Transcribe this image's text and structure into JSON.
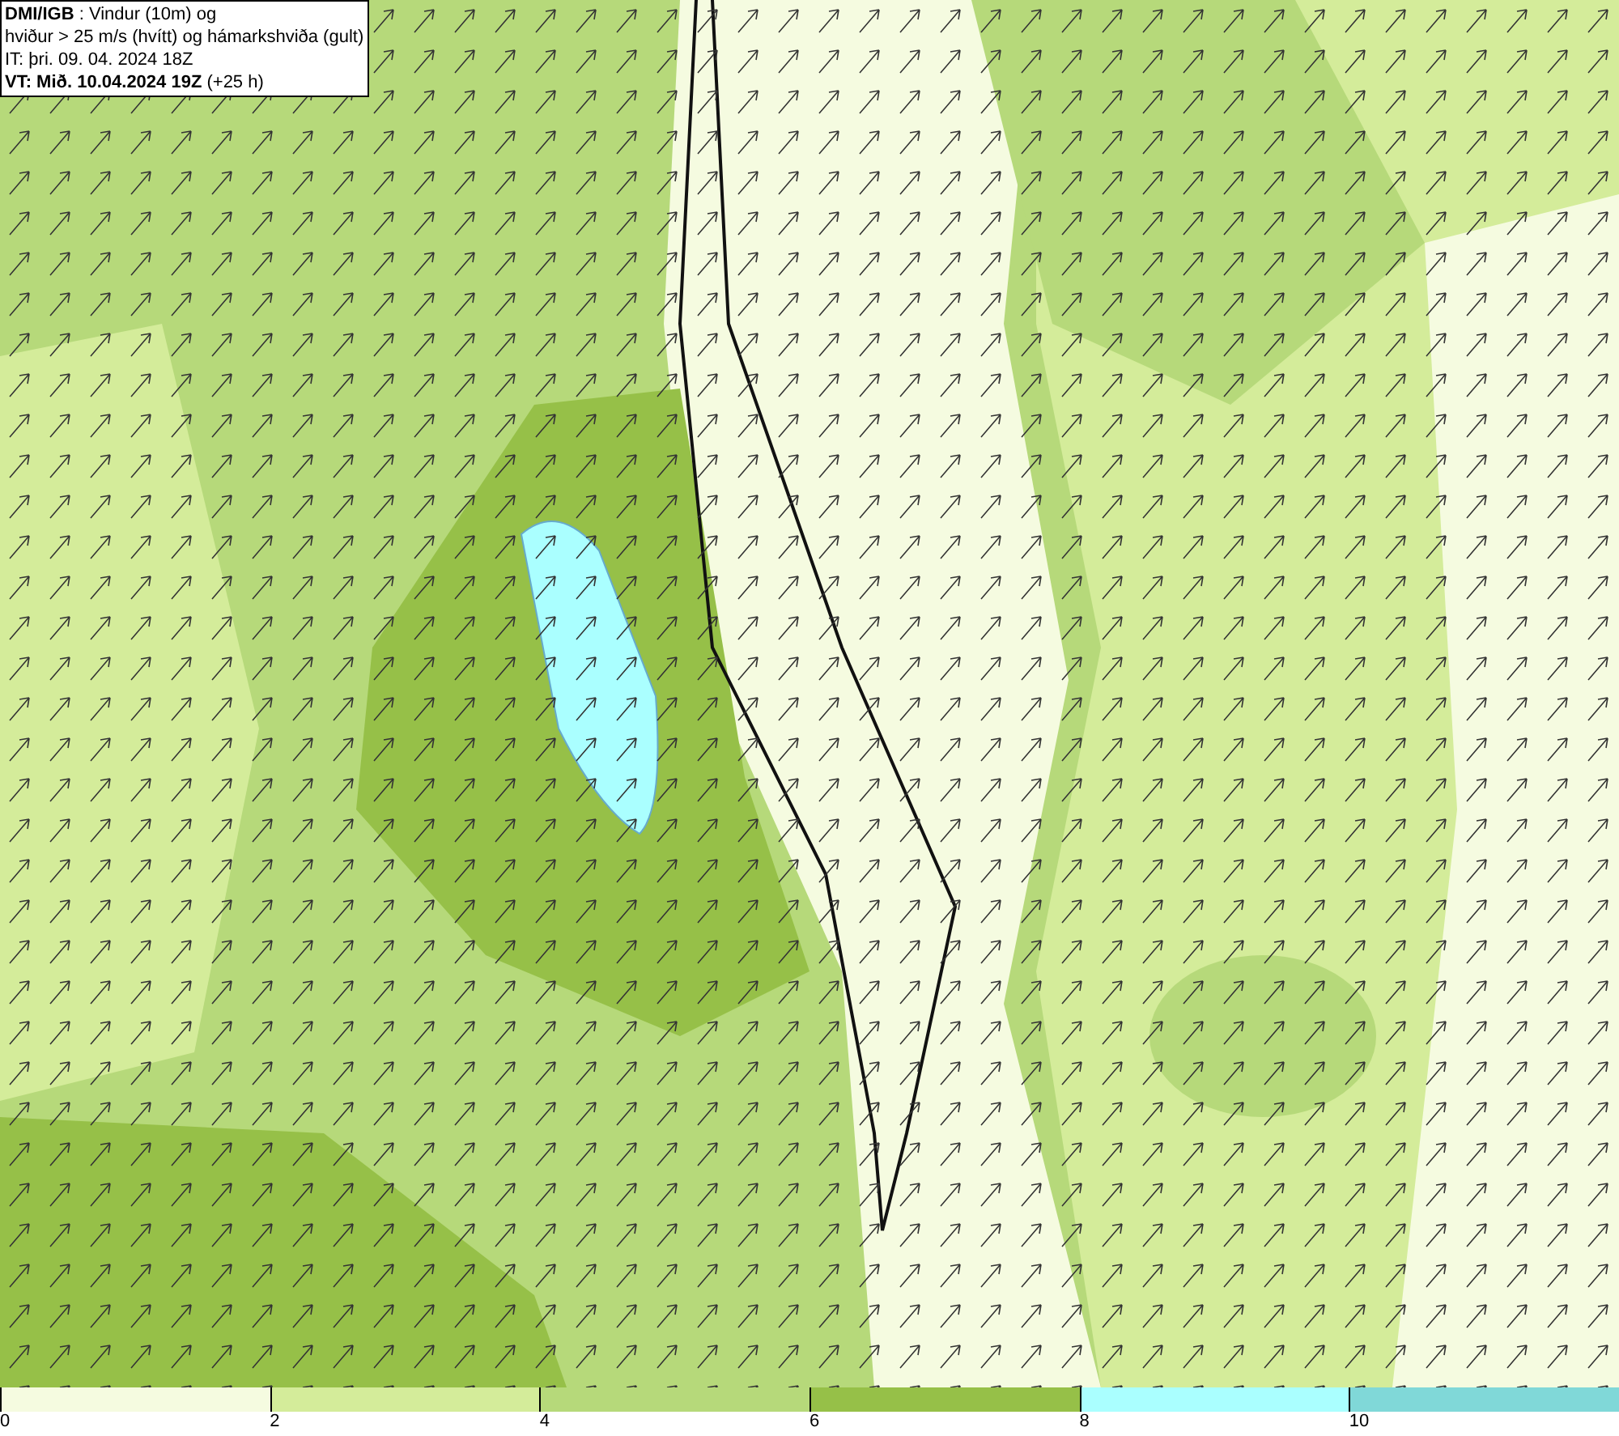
{
  "header": {
    "lines": [
      "**DMI/IGB** : Vindur (10m) og",
      "hviður > 25 m/s (hvítt) og hámarkshviða (gult)",
      "IT: þri. 09. 04. 2024 18Z",
      "**VT: Mið. 10.04.2024 19Z** (+25 h)"
    ]
  },
  "legend": {
    "segments": [
      {
        "label": "0",
        "color": "#f5fbe0"
      },
      {
        "label": "2",
        "color": "#d4ec9a"
      },
      {
        "label": "4",
        "color": "#b6d97a"
      },
      {
        "label": "6",
        "color": "#96c048"
      },
      {
        "label": "8",
        "color": "#aaffff"
      },
      {
        "label": "10",
        "color": "#80d8d8"
      }
    ]
  }
}
